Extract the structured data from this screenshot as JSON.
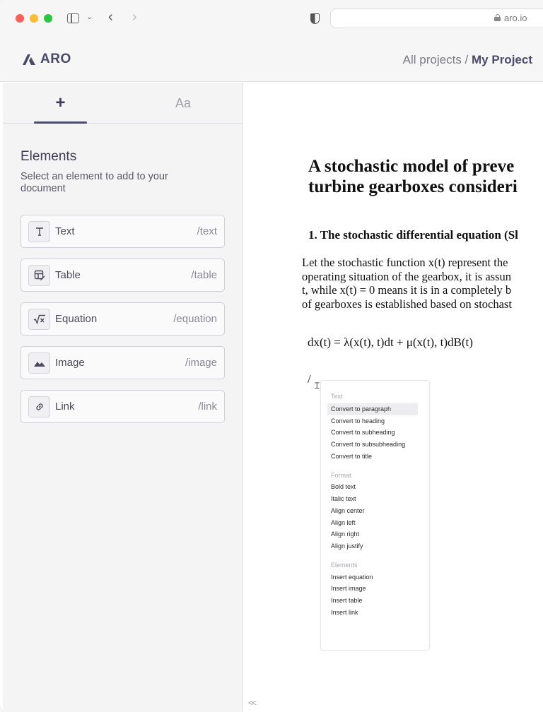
{
  "browser": {
    "url": "aro.io"
  },
  "app": {
    "logo_text": "ARO",
    "breadcrumb": {
      "parent": "All projects",
      "separator": "/",
      "current": "My Project"
    }
  },
  "left_panel": {
    "tabs": [
      {
        "label": "+",
        "icon": "plus-icon",
        "active": true
      },
      {
        "label": "Aa",
        "icon": "typography-icon",
        "active": false
      }
    ],
    "title": "Elements",
    "description": "Select an element to add to your document",
    "elements": [
      {
        "label": "Text",
        "command": "/text",
        "icon": "text-icon"
      },
      {
        "label": "Table",
        "command": "/table",
        "icon": "table-edit-icon"
      },
      {
        "label": "Equation",
        "command": "/equation",
        "icon": "square-root-icon"
      },
      {
        "label": "Image",
        "command": "/image",
        "icon": "image-icon"
      },
      {
        "label": "Link",
        "command": "/link",
        "icon": "link-icon"
      }
    ]
  },
  "document": {
    "title_line1": "A stochastic model of preve",
    "title_line2": "turbine gearboxes consideri",
    "section_heading": "1. The stochastic differential equation (Sl",
    "paragraph_lines": [
      "Let the stochastic function x(t) represent the",
      "operating situation of the gearbox, it is assun",
      "t, while x(t) = 0 means it is in a completely b",
      "of gearboxes is established based on stochast"
    ],
    "equation": "dx(t) = λ(x(t), t)dt + μ(x(t), t)dB(t)",
    "command_input": "/"
  },
  "command_menu": {
    "groups": [
      {
        "label": "Text",
        "items": [
          "Convert to paragraph",
          "Convert to heading",
          "Convert to subheading",
          "Convert to subsubheading",
          "Convert to title"
        ]
      },
      {
        "label": "Format",
        "items": [
          "Bold text",
          "Italic text",
          "Align center",
          "Align left",
          "Align right",
          "Align justify"
        ]
      },
      {
        "label": "Elements",
        "items": [
          "Insert equation",
          "Insert image",
          "Insert table",
          "Insert link"
        ]
      }
    ],
    "highlighted_item": "Convert to paragraph"
  },
  "footer": {
    "collapse_label": "<<"
  },
  "colors": {
    "brand": "#4a4a6a",
    "panel_bg": "#f4f4f5",
    "menu_hover": "#ededef"
  }
}
